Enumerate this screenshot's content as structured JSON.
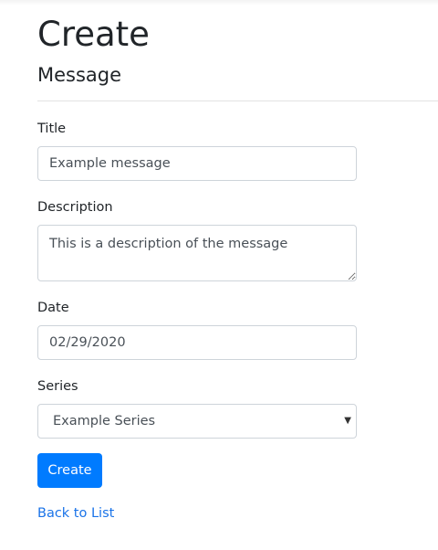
{
  "header": {
    "title": "Create",
    "subtitle": "Message"
  },
  "form": {
    "title": {
      "label": "Title",
      "value": "Example message"
    },
    "description": {
      "label": "Description",
      "value": "This is a description of the message"
    },
    "date": {
      "label": "Date",
      "value": "02/29/2020"
    },
    "series": {
      "label": "Series",
      "selected": "Example Series"
    },
    "submit_label": "Create"
  },
  "links": {
    "back": "Back to List"
  },
  "colors": {
    "primary": "#007bff",
    "link": "#1a73e8",
    "border": "#ced4da"
  }
}
